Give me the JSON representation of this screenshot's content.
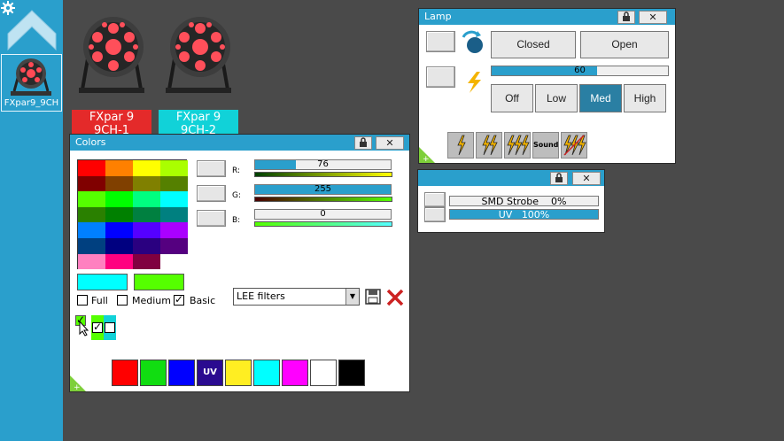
{
  "sidebar": {
    "fixture_label": "FXpar9_9CH"
  },
  "stage": {
    "fixtures": [
      {
        "line1": "FXpar 9",
        "line2": "9CH-1",
        "color": "#e42a2a"
      },
      {
        "line1": "FXpar 9",
        "line2": "9CH-2",
        "color": "#11d2d8"
      }
    ]
  },
  "colors_panel": {
    "title": "Colors",
    "channels": [
      {
        "label": "R:",
        "value": "76",
        "level": 0.3
      },
      {
        "label": "G:",
        "value": "255",
        "level": 1.0
      },
      {
        "label": "B:",
        "value": "0",
        "level": 0.0
      }
    ],
    "palette": [
      [
        "#ff0000",
        "#ff8000",
        "#ffff00",
        "#aaff00"
      ],
      [
        "#800000",
        "#804000",
        "#808000",
        "#558000"
      ],
      [
        "#55ff00",
        "#00ff00",
        "#00ff80",
        "#00ffff"
      ],
      [
        "#2a8000",
        "#008000",
        "#008040",
        "#008080"
      ],
      [
        "#0080ff",
        "#0000ff",
        "#5500ff",
        "#aa00ff"
      ],
      [
        "#004080",
        "#000080",
        "#2a0080",
        "#550080"
      ],
      [
        "#ff80c0",
        "#ff0080",
        "#800040",
        "#ffffff"
      ]
    ],
    "selected_colors": [
      "#00ffff",
      "#55ff00"
    ],
    "options": {
      "full": "Full",
      "medium": "Medium",
      "basic": "Basic"
    },
    "filter_select": "LEE filters",
    "quick_colors": [
      {
        "color": "#ff0000",
        "label": ""
      },
      {
        "color": "#11dd11",
        "label": ""
      },
      {
        "color": "#0000ff",
        "label": ""
      },
      {
        "color": "#2a0a90",
        "label": "UV"
      },
      {
        "color": "#ffee22",
        "label": ""
      },
      {
        "color": "#00ffff",
        "label": ""
      },
      {
        "color": "#ff00ff",
        "label": ""
      },
      {
        "color": "#ffffff",
        "label": ""
      },
      {
        "color": "#000000",
        "label": ""
      }
    ]
  },
  "lamp_panel": {
    "title": "Lamp",
    "closed_label": "Closed",
    "open_label": "Open",
    "dimmer_value": "60",
    "dimmer_level": 0.6,
    "speeds": [
      "Off",
      "Low",
      "Med",
      "High"
    ],
    "selected_speed": "Med",
    "sound_label": "Sound"
  },
  "strobe_panel": {
    "rows": [
      {
        "label": "SMD Strobe",
        "value": "0%",
        "level": 0.0
      },
      {
        "label": "UV",
        "value": "100%",
        "level": 1.0
      }
    ]
  },
  "theme": {
    "accent": "#2a9fcc",
    "background": "#4a4a4a"
  }
}
